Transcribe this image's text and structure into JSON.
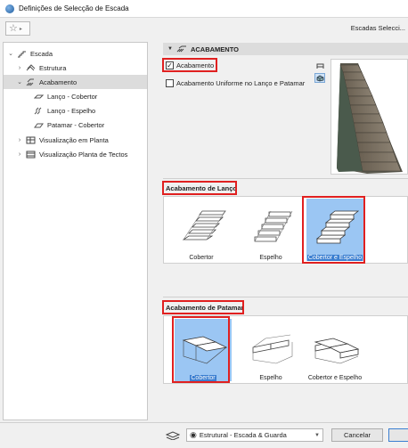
{
  "window": {
    "title": "Definições de Selecção de Escada"
  },
  "toolbar": {
    "favorite_glyph": "☆",
    "caret_glyph": "▸",
    "selection_label": "Escadas Selecci..."
  },
  "tree": {
    "items": [
      {
        "label": "Escada",
        "expanded": true,
        "icon": "stair-icon"
      },
      {
        "label": "Estrutura",
        "expanded": false,
        "icon": "structure-icon"
      },
      {
        "label": "Acabamento",
        "expanded": true,
        "selected": true,
        "icon": "finish-icon"
      },
      {
        "label": "Lanço - Cobertor",
        "icon": "tread-icon"
      },
      {
        "label": "Lanço - Espelho",
        "icon": "riser-icon"
      },
      {
        "label": "Patamar - Cobertor",
        "icon": "landing-tread-icon"
      },
      {
        "label": "Visualização em Planta",
        "expanded": false,
        "icon": "floor-plan-icon"
      },
      {
        "label": "Visualização Planta de Tectos",
        "expanded": false,
        "icon": "ceiling-plan-icon"
      }
    ]
  },
  "panel": {
    "header": "ACABAMENTO",
    "finish_checkbox": {
      "label": "Acabamento",
      "checked": true
    },
    "uniform_checkbox": {
      "label": "Acabamento Uniforme no Lanço e Patamar",
      "checked": false
    },
    "preview_buttons": [
      {
        "icon": "stair-2d-icon",
        "active": false
      },
      {
        "icon": "stair-3d-icon",
        "active": true
      }
    ]
  },
  "flight_finish": {
    "title": "Acabamento de Lanço",
    "options": [
      {
        "label": "Cobertor",
        "selected": false
      },
      {
        "label": "Espelho",
        "selected": false
      },
      {
        "label": "Cobertor e Espelho",
        "selected": true
      }
    ]
  },
  "landing_finish": {
    "title": "Acabamento de Patamar",
    "options": [
      {
        "label": "Cobertor",
        "selected": true
      },
      {
        "label": "Espelho",
        "selected": false
      },
      {
        "label": "Cobertor e Espelho",
        "selected": false
      }
    ]
  },
  "footer": {
    "layer": "Estrutural - Escada & Guarda",
    "cancel_label": "Cancelar"
  },
  "colors": {
    "highlight": "#e02020",
    "selection": "#9bc6f3",
    "selection_label": "#3b7fd1"
  }
}
